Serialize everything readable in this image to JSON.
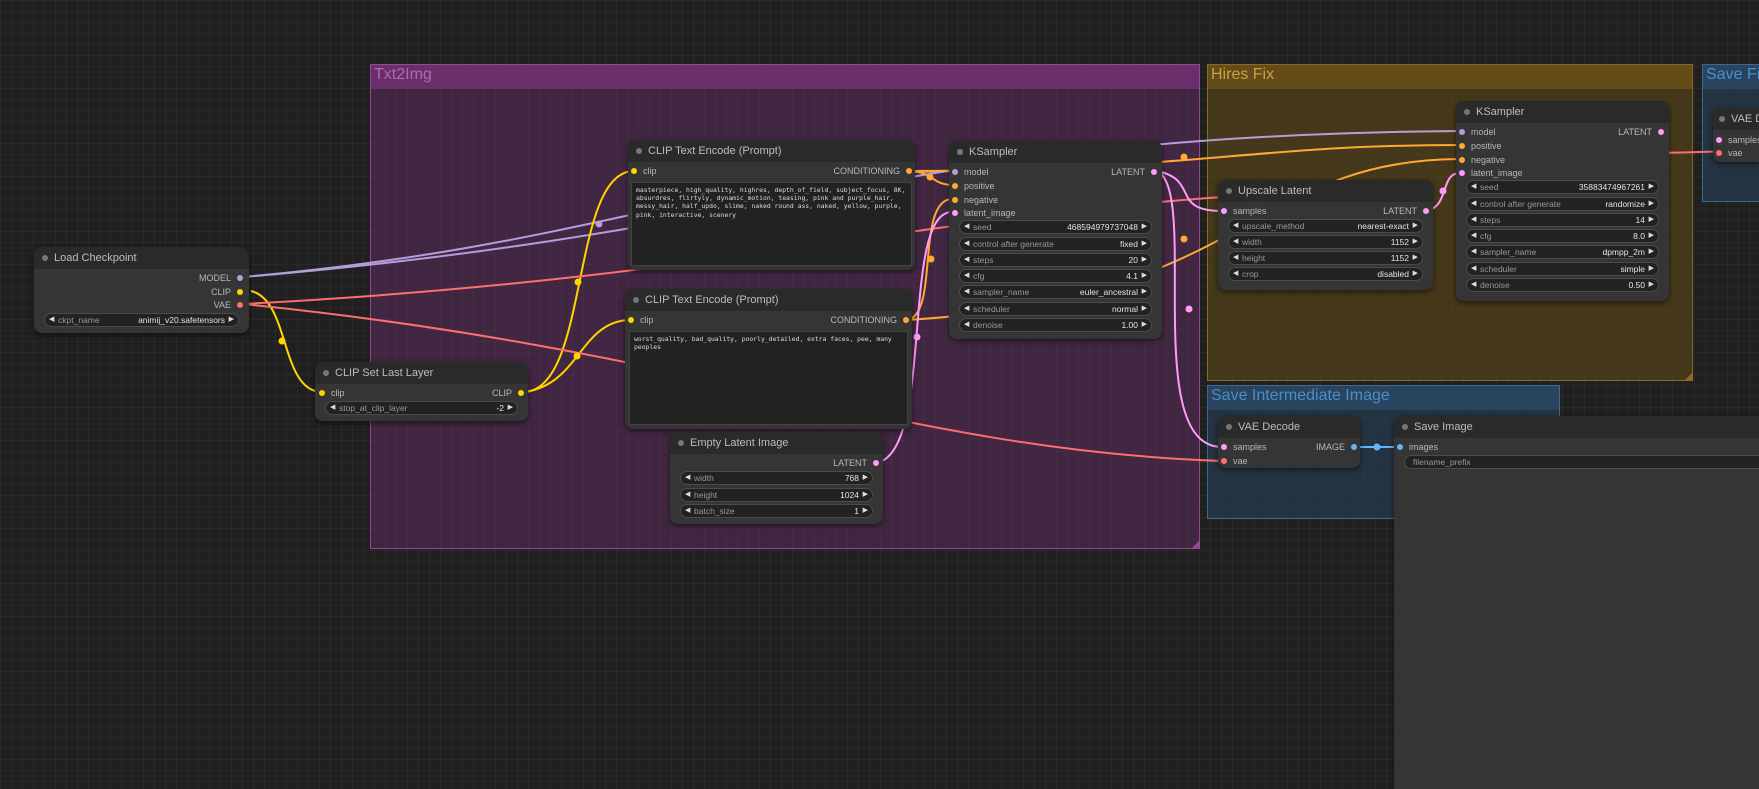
{
  "colors": {
    "model": "#b39ddb",
    "clip": "#ffd500",
    "vae": "#ff6e6e",
    "conditioning": "#ffa931",
    "latent": "#ff9cf9",
    "image": "#64b5f6"
  },
  "groups": {
    "txt2img": {
      "title": "Txt2Img",
      "color": "#b06bb0"
    },
    "hires_fix": {
      "title": "Hires Fix",
      "color": "#c09a3a"
    },
    "save_final": {
      "title": "Save Fi",
      "color": "#4a8fc8"
    },
    "save_intermediate": {
      "title": "Save Intermediate Image",
      "color": "#4a8fc8"
    }
  },
  "load_checkpoint": {
    "title": "Load Checkpoint",
    "outputs": [
      "MODEL",
      "CLIP",
      "VAE"
    ],
    "ckpt_name": {
      "label": "ckpt_name",
      "value": "animij_v20.safetensors"
    }
  },
  "clip_set_last_layer": {
    "title": "CLIP Set Last Layer",
    "input": "clip",
    "output": "CLIP",
    "stop_at_clip_layer": {
      "label": "stop_at_clip_layer",
      "value": "-2"
    }
  },
  "clip_text_positive": {
    "title": "CLIP Text Encode (Prompt)",
    "input": "clip",
    "output": "CONDITIONING",
    "text": "masterpiece, high_quality, highres, depth_of_field, subject_focus, 8K, absurdres, flirtyly, dynamic_motion, teasing, pink and purple_hair, messy_hair, half_updo, slime, naked round ass, naked, yellow, purple, pink, interactive, scenery"
  },
  "clip_text_negative": {
    "title": "CLIP Text Encode (Prompt)",
    "input": "clip",
    "output": "CONDITIONING",
    "text": "worst_quality, bad_quality, poorly_detailed, extra faces, pee, many peoples"
  },
  "empty_latent": {
    "title": "Empty Latent Image",
    "output": "LATENT",
    "widgets": [
      {
        "label": "width",
        "value": "768"
      },
      {
        "label": "height",
        "value": "1024"
      },
      {
        "label": "batch_size",
        "value": "1"
      }
    ]
  },
  "ksampler_1": {
    "title": "KSampler",
    "inputs": [
      "model",
      "positive",
      "negative",
      "latent_image"
    ],
    "output": "LATENT",
    "widgets": [
      {
        "label": "seed",
        "value": "468594979737048"
      },
      {
        "label": "control after generate",
        "value": "fixed"
      },
      {
        "label": "steps",
        "value": "20"
      },
      {
        "label": "cfg",
        "value": "4.1"
      },
      {
        "label": "sampler_name",
        "value": "euler_ancestral"
      },
      {
        "label": "scheduler",
        "value": "normal"
      },
      {
        "label": "denoise",
        "value": "1.00"
      }
    ]
  },
  "upscale_latent": {
    "title": "Upscale Latent",
    "input": "samples",
    "output": "LATENT",
    "widgets": [
      {
        "label": "upscale_method",
        "value": "nearest-exact"
      },
      {
        "label": "width",
        "value": "1152"
      },
      {
        "label": "height",
        "value": "1152"
      },
      {
        "label": "crop",
        "value": "disabled"
      }
    ]
  },
  "ksampler_2": {
    "title": "KSampler",
    "inputs": [
      "model",
      "positive",
      "negative",
      "latent_image"
    ],
    "output": "LATENT",
    "widgets": [
      {
        "label": "seed",
        "value": "35883474967261"
      },
      {
        "label": "control after generate",
        "value": "randomize"
      },
      {
        "label": "steps",
        "value": "14"
      },
      {
        "label": "cfg",
        "value": "8.0"
      },
      {
        "label": "sampler_name",
        "value": "dpmpp_2m"
      },
      {
        "label": "scheduler",
        "value": "simple"
      },
      {
        "label": "denoise",
        "value": "0.50"
      }
    ]
  },
  "vae_decode_1": {
    "title": "VAE Decode",
    "inputs": [
      "samples",
      "vae"
    ],
    "output": "IMAGE"
  },
  "save_image": {
    "title": "Save Image",
    "input": "images",
    "filename_prefix": "filename_prefix"
  },
  "vae_decode_2": {
    "title": "VAE D",
    "inputs": [
      "samples",
      "vae"
    ]
  }
}
